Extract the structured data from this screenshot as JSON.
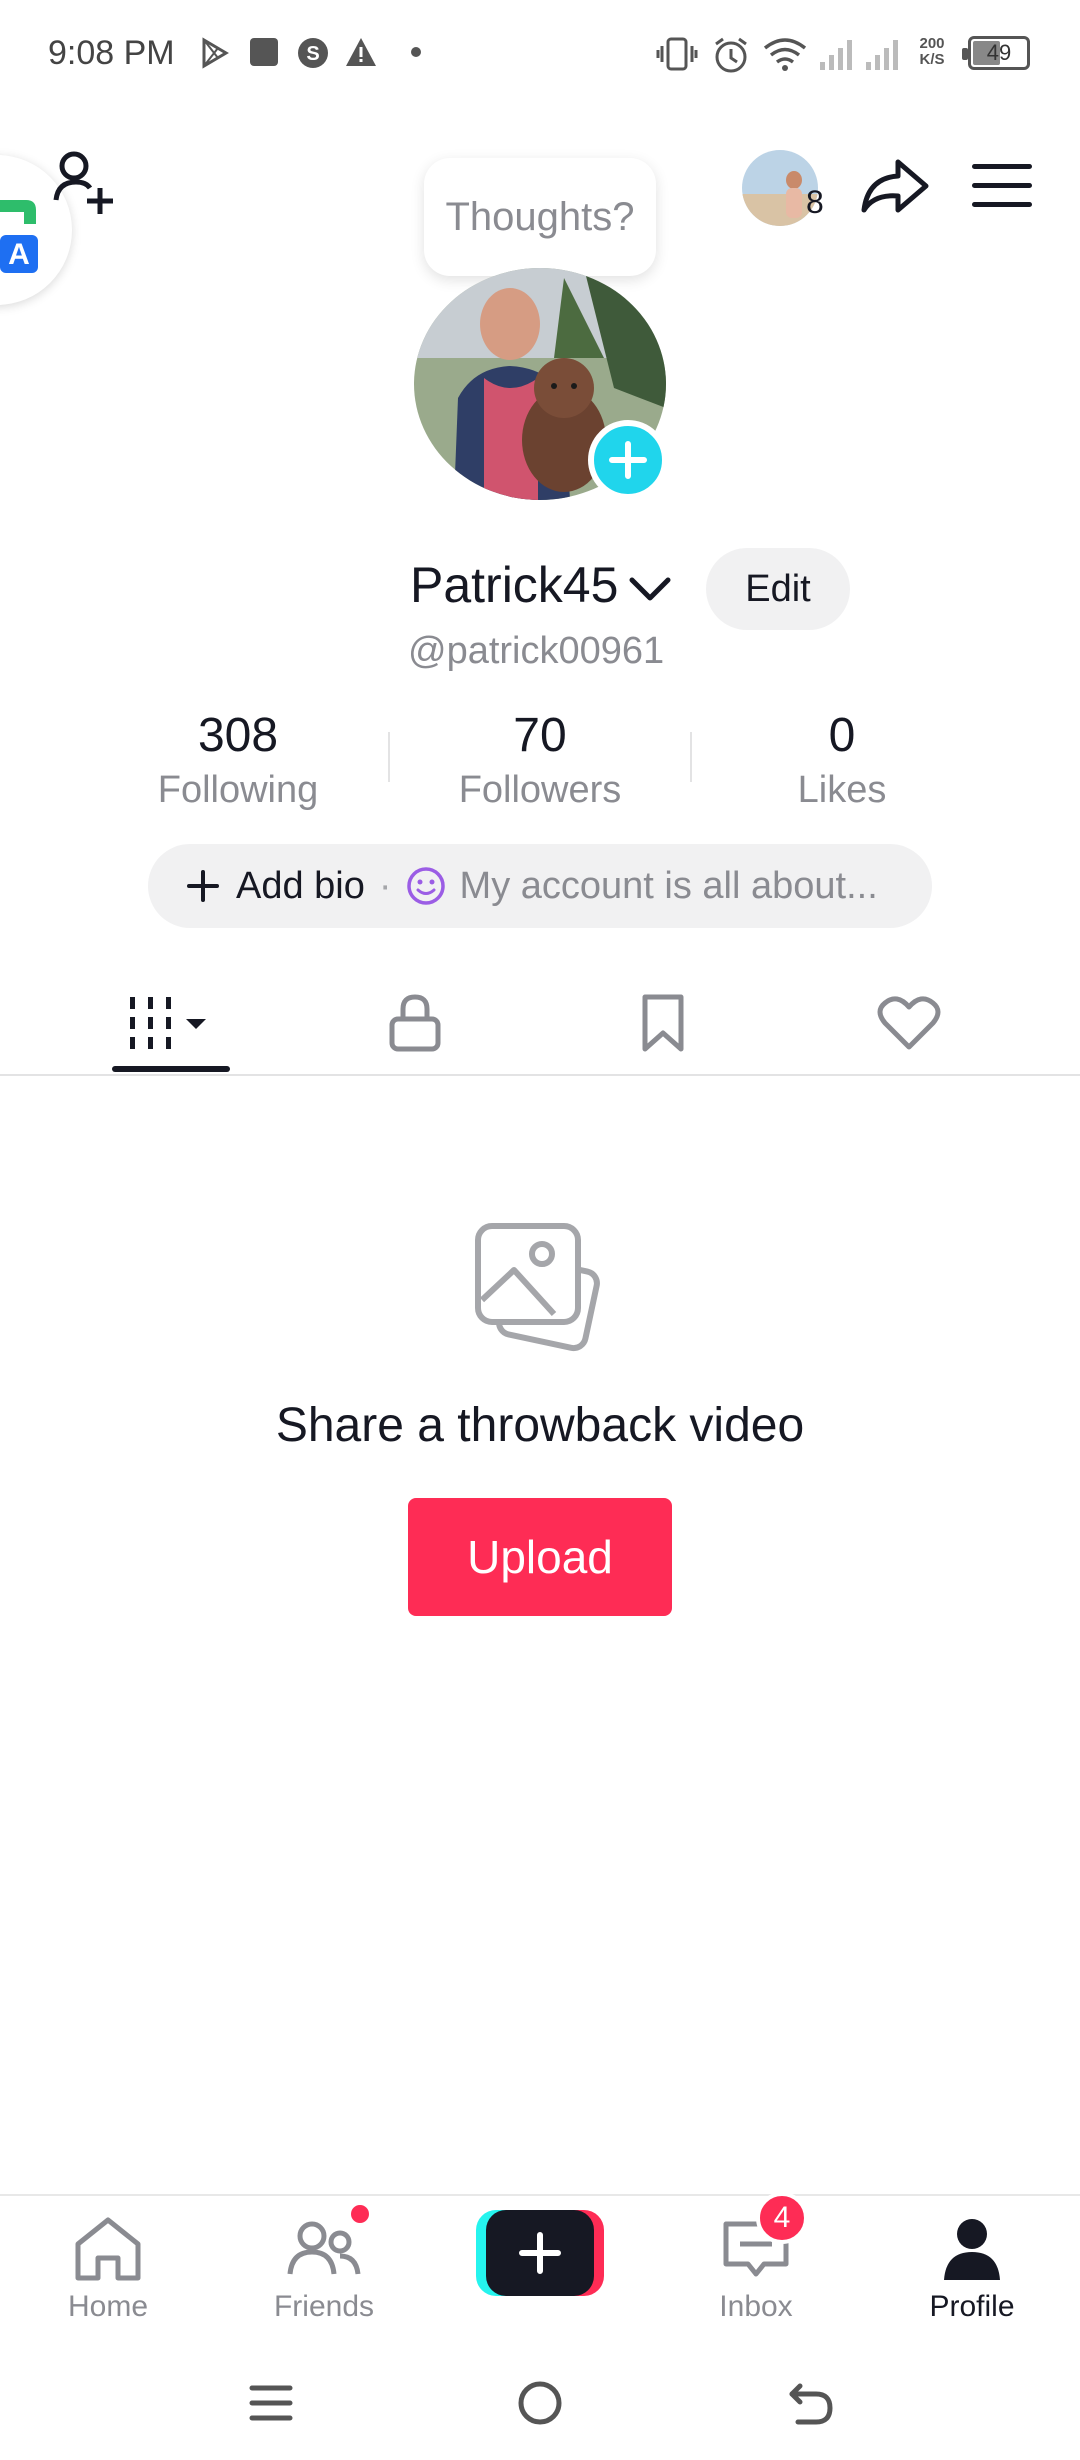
{
  "status_bar": {
    "time": "9:08 PM",
    "network_speed_value": "200",
    "network_speed_unit": "K/S",
    "battery": "49"
  },
  "header": {
    "thoughts_placeholder": "Thoughts?",
    "story_count": "8"
  },
  "profile": {
    "username": "Patrick45",
    "edit_label": "Edit",
    "handle": "@patrick00961"
  },
  "stats": [
    {
      "value": "308",
      "label": "Following"
    },
    {
      "value": "70",
      "label": "Followers"
    },
    {
      "value": "0",
      "label": "Likes"
    }
  ],
  "bio": {
    "add_label": "Add bio",
    "separator": "·",
    "placeholder": "My account is all about..."
  },
  "tabs": [
    "videos-icon",
    "lock-icon",
    "bookmark-icon",
    "heart-icon"
  ],
  "empty_state": {
    "title": "Share a throwback video",
    "upload_label": "Upload"
  },
  "bottom_nav": {
    "home": "Home",
    "friends": "Friends",
    "inbox": "Inbox",
    "inbox_badge": "4",
    "profile": "Profile"
  },
  "colors": {
    "accent_red": "#fe2c55",
    "accent_cyan": "#20d5ec",
    "text_primary": "#161823",
    "text_secondary": "#8a8b91"
  }
}
